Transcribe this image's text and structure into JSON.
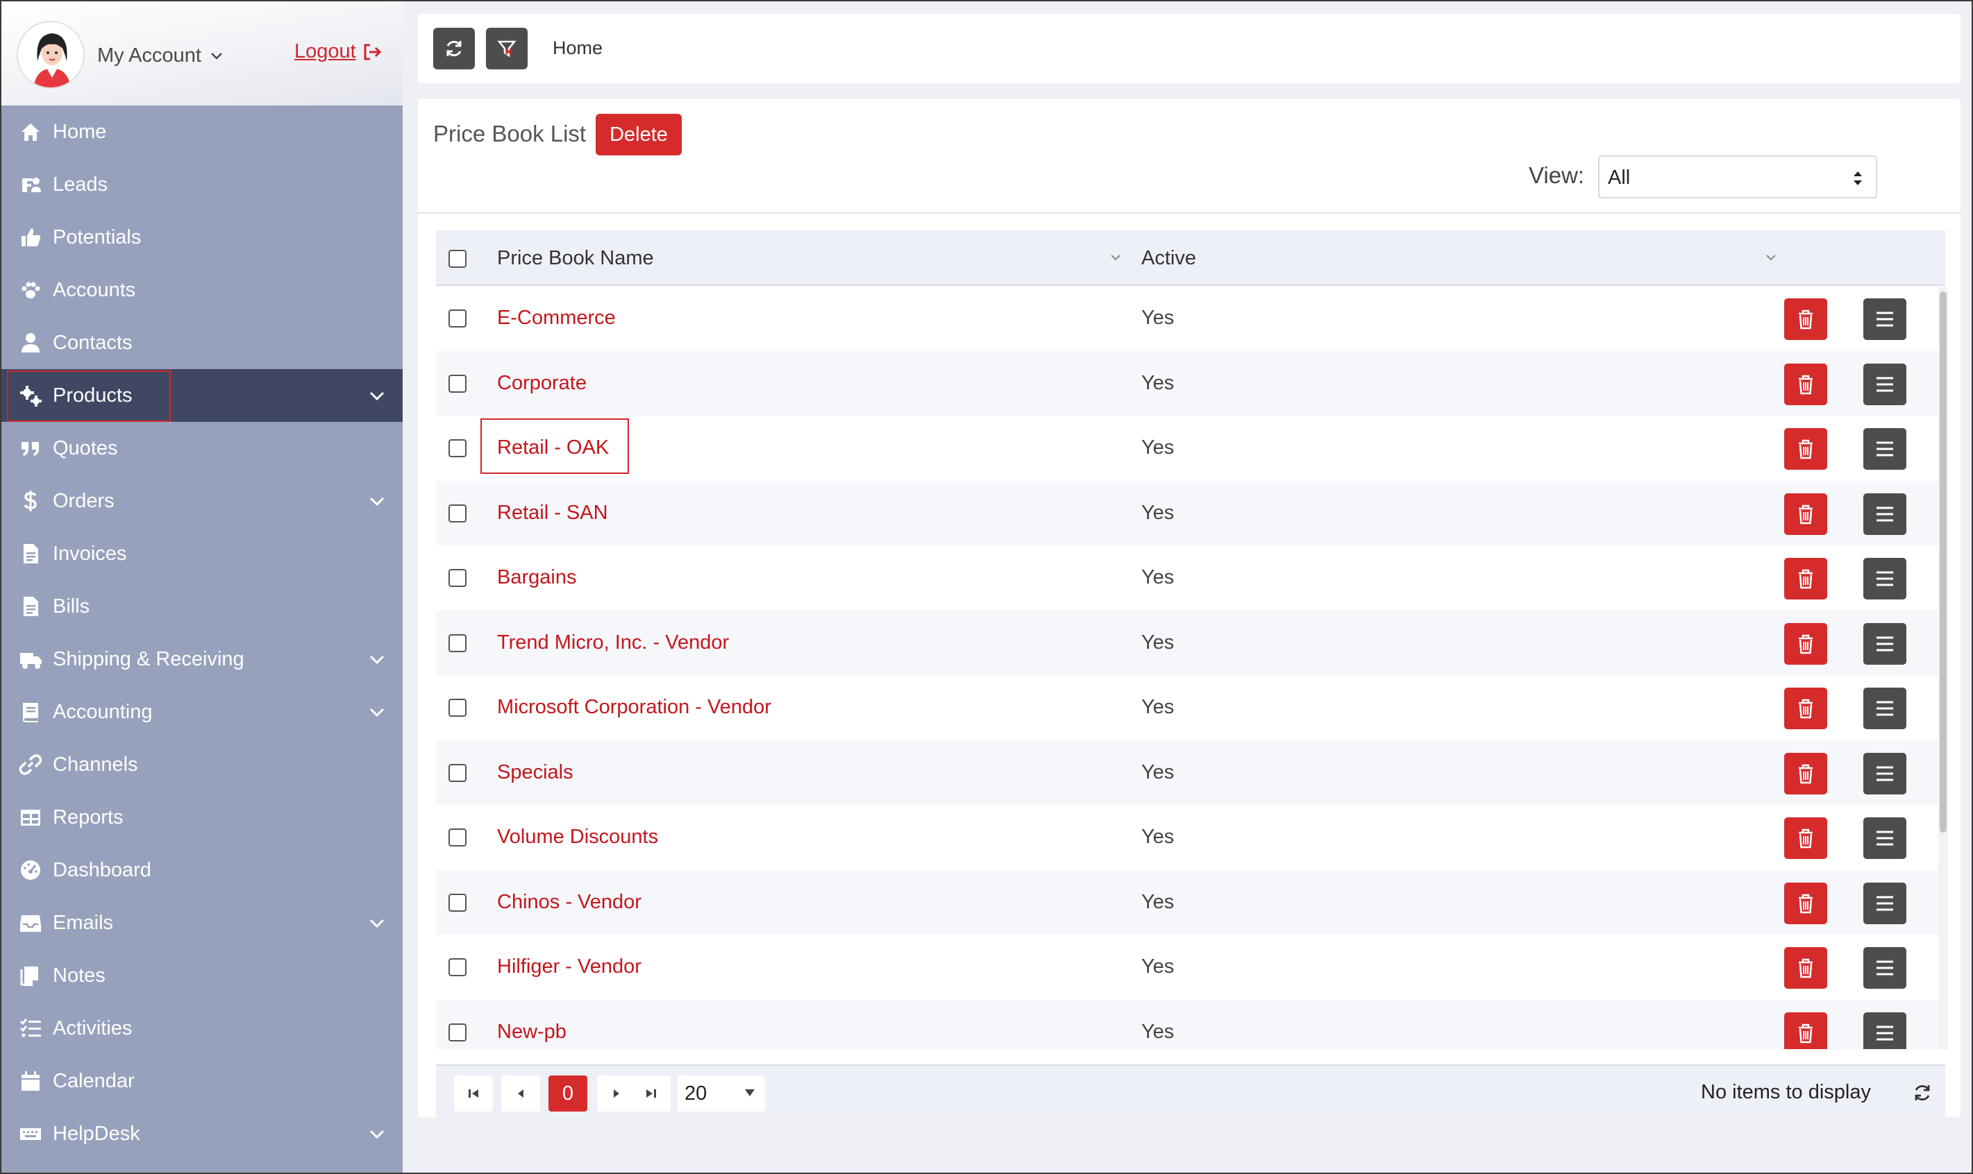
{
  "account": {
    "label": "My Account",
    "logout_label": "Logout"
  },
  "sidebar": {
    "items": [
      {
        "label": "Home",
        "icon": "home-icon",
        "chevron": false
      },
      {
        "label": "Leads",
        "icon": "leads-icon",
        "chevron": false
      },
      {
        "label": "Potentials",
        "icon": "thumbs-up-icon",
        "chevron": false
      },
      {
        "label": "Accounts",
        "icon": "paw-icon",
        "chevron": false
      },
      {
        "label": "Contacts",
        "icon": "user-icon",
        "chevron": false
      },
      {
        "label": "Products",
        "icon": "cogs-icon",
        "chevron": true,
        "active": true
      },
      {
        "label": "Quotes",
        "icon": "quote-icon",
        "chevron": false
      },
      {
        "label": "Orders",
        "icon": "dollar-icon",
        "chevron": true
      },
      {
        "label": "Invoices",
        "icon": "document-icon",
        "chevron": false
      },
      {
        "label": "Bills",
        "icon": "document-icon",
        "chevron": false
      },
      {
        "label": "Shipping & Receiving",
        "icon": "truck-icon",
        "chevron": true
      },
      {
        "label": "Accounting",
        "icon": "book-icon",
        "chevron": true
      },
      {
        "label": "Channels",
        "icon": "link-icon",
        "chevron": false
      },
      {
        "label": "Reports",
        "icon": "table-icon",
        "chevron": false
      },
      {
        "label": "Dashboard",
        "icon": "gauge-icon",
        "chevron": false
      },
      {
        "label": "Emails",
        "icon": "inbox-icon",
        "chevron": true
      },
      {
        "label": "Notes",
        "icon": "notes-icon",
        "chevron": false
      },
      {
        "label": "Activities",
        "icon": "checklist-icon",
        "chevron": false
      },
      {
        "label": "Calendar",
        "icon": "calendar-icon",
        "chevron": false
      },
      {
        "label": "HelpDesk",
        "icon": "keyboard-icon",
        "chevron": true
      }
    ]
  },
  "topbar": {
    "breadcrumb": "Home"
  },
  "panel": {
    "title": "Price Book List",
    "delete_label": "Delete",
    "view_label": "View:",
    "view_value": "All"
  },
  "grid": {
    "columns": [
      "Price Book Name",
      "Active"
    ],
    "rows": [
      {
        "name": "E-Commerce",
        "active": "Yes"
      },
      {
        "name": "Corporate",
        "active": "Yes"
      },
      {
        "name": "Retail - OAK",
        "active": "Yes"
      },
      {
        "name": "Retail - SAN",
        "active": "Yes"
      },
      {
        "name": "Bargains",
        "active": "Yes"
      },
      {
        "name": "Trend Micro, Inc. - Vendor",
        "active": "Yes"
      },
      {
        "name": "Microsoft Corporation - Vendor",
        "active": "Yes"
      },
      {
        "name": "Specials",
        "active": "Yes"
      },
      {
        "name": "Volume Discounts",
        "active": "Yes"
      },
      {
        "name": "Chinos - Vendor",
        "active": "Yes"
      },
      {
        "name": "Hilfiger - Vendor",
        "active": "Yes"
      },
      {
        "name": "New-pb",
        "active": "Yes"
      }
    ]
  },
  "pager": {
    "current_page": "0",
    "page_size": "20",
    "info": "No items to display"
  },
  "colors": {
    "accent_red": "#d52b2b",
    "sidebar_bg": "#98a1bc",
    "sidebar_active": "#3f4763",
    "dark_button": "#4d4d4d"
  }
}
